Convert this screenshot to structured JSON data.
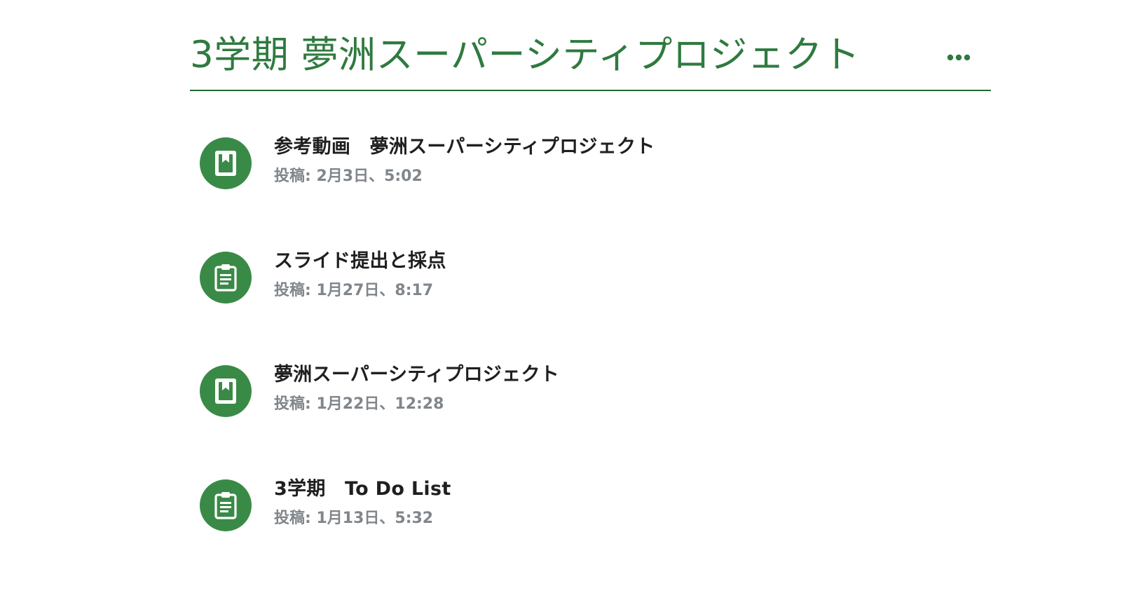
{
  "topic": {
    "title": "3学期 夢洲スーパーシティプロジェクト",
    "menu_icon": "more-horizontal-icon",
    "accent_color": "#2f7a3f"
  },
  "items": [
    {
      "type": "material",
      "icon": "book-icon",
      "title": "参考動画　夢洲スーパーシティプロジェクト",
      "posted": "投稿: 2月3日、5:02"
    },
    {
      "type": "assignment",
      "icon": "clipboard-icon",
      "title": "スライド提出と採点",
      "posted": "投稿: 1月27日、8:17"
    },
    {
      "type": "material",
      "icon": "book-icon",
      "title": "夢洲スーパーシティプロジェクト",
      "posted": "投稿: 1月22日、12:28"
    },
    {
      "type": "assignment",
      "icon": "clipboard-icon",
      "title": "3学期　To Do List",
      "posted": "投稿: 1月13日、5:32"
    }
  ]
}
